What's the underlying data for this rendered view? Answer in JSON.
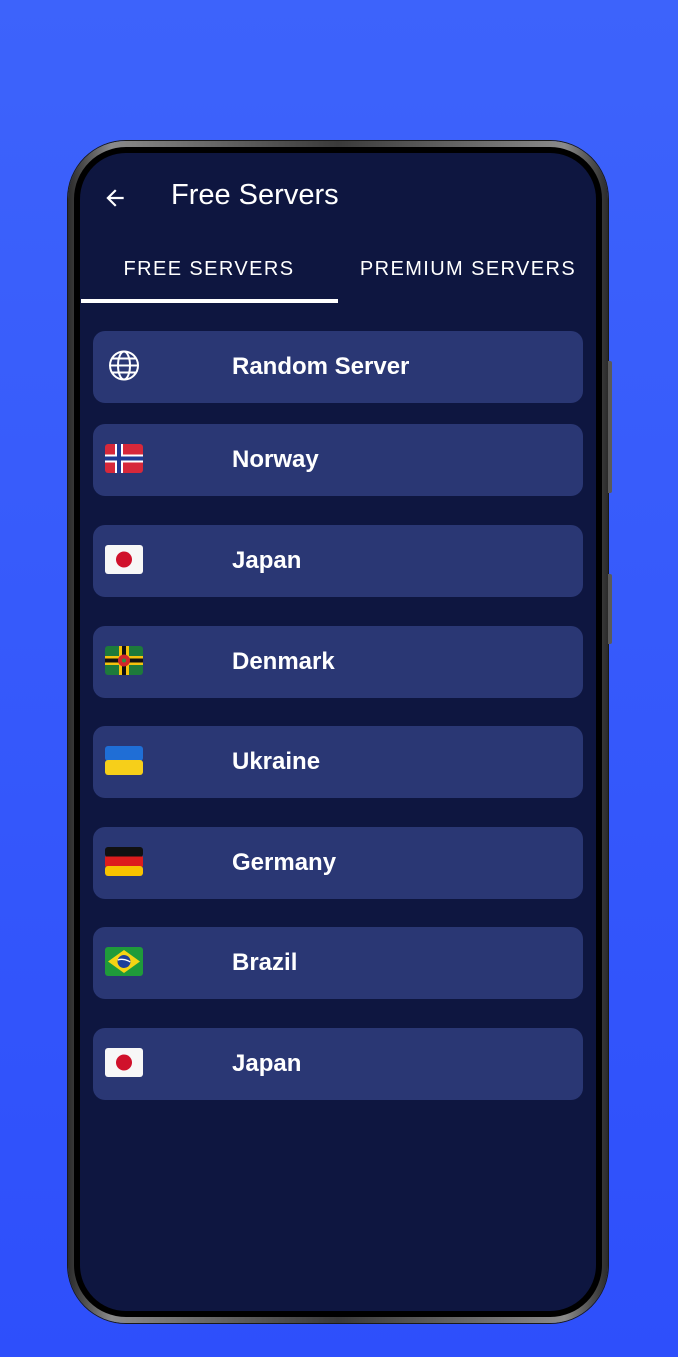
{
  "app": {
    "title": "Free Servers",
    "back_icon": "arrow-left-icon"
  },
  "tabs": [
    {
      "label": "FREE SERVERS",
      "selected": true
    },
    {
      "label": "PREMIUM SERVERS",
      "selected": false
    }
  ],
  "servers": [
    {
      "name": "Random Server",
      "icon": "globe-icon"
    },
    {
      "name": "Norway",
      "icon": "norway-flag-icon"
    },
    {
      "name": "Japan",
      "icon": "japan-flag-icon"
    },
    {
      "name": "Denmark",
      "icon": "dominica-flag-icon"
    },
    {
      "name": "Ukraine",
      "icon": "ukraine-flag-icon"
    },
    {
      "name": "Germany",
      "icon": "germany-flag-icon"
    },
    {
      "name": "Brazil",
      "icon": "brazil-flag-icon"
    },
    {
      "name": "Japan",
      "icon": "japan-flag-icon"
    }
  ],
  "colors": {
    "background": "#3d63fb",
    "screen": "#0e1640",
    "row": "#2a3774",
    "text": "#ffffff"
  }
}
